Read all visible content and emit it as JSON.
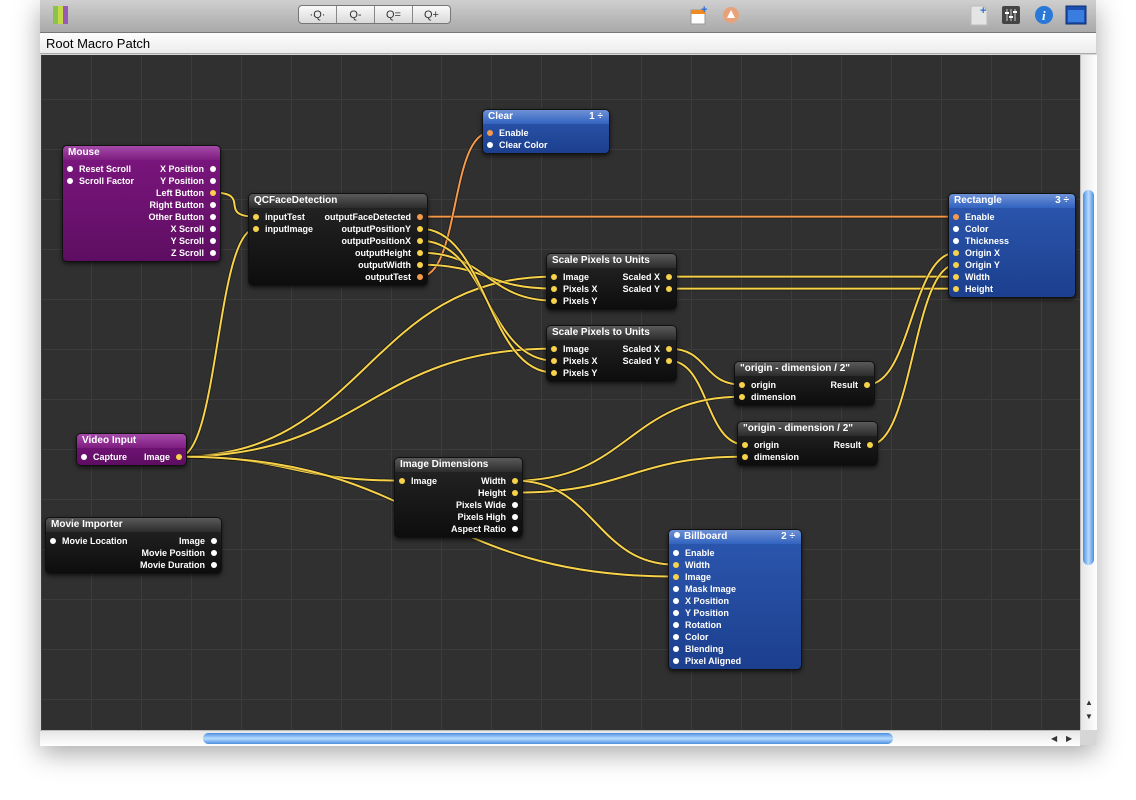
{
  "toolbar": {
    "icons": [
      "patch-library-icon",
      "zoom-fit-icon",
      "zoom-out-icon",
      "zoom-actual-icon",
      "zoom-in-icon",
      "add-note-icon",
      "parent-patch-icon",
      "new-document-icon",
      "patch-parameters-icon",
      "patch-inspector-icon",
      "viewer-icon"
    ],
    "zoom_buttons": [
      "·Q·",
      "Q-",
      "Q=",
      "Q+"
    ]
  },
  "path_bar": {
    "title": "Root Macro Patch"
  },
  "colors": {
    "canvas": "#303030",
    "cable_value": "#f7d24a",
    "cable_boolean": "#f49a4a",
    "consumer_patch": "#2c58b0",
    "provider_patch": "#7d1680",
    "processor_patch": "#1a1a1a"
  },
  "patches": [
    {
      "id": "mouse",
      "title": "Mouse",
      "kind": "purple",
      "inputs": [
        "Reset Scroll",
        "Scroll Factor"
      ],
      "outputs": [
        "X Position",
        "Y Position",
        "Left Button",
        "Right Button",
        "Other Button",
        "X Scroll",
        "Y Scroll",
        "Z Scroll"
      ]
    },
    {
      "id": "face",
      "title": "QCFaceDetection",
      "kind": "dark",
      "inputs": [
        "inputTest",
        "inputImage"
      ],
      "outputs": [
        "outputFaceDetected",
        "outputPositionY",
        "outputPositionX",
        "outputHeight",
        "outputWidth",
        "outputTest"
      ]
    },
    {
      "id": "clear",
      "title": "Clear",
      "kind": "blue",
      "badge": "1 ÷",
      "inputs": [
        "Enable",
        "Clear Color"
      ],
      "outputs": []
    },
    {
      "id": "rect",
      "title": "Rectangle",
      "kind": "blue",
      "badge": "3 ÷",
      "inputs": [
        "Enable",
        "Color",
        "Thickness",
        "Origin X",
        "Origin Y",
        "Width",
        "Height"
      ],
      "outputs": []
    },
    {
      "id": "scale1",
      "title": "Scale Pixels to Units",
      "kind": "dark",
      "inputs": [
        "Image",
        "Pixels X",
        "Pixels Y"
      ],
      "outputs": [
        "Scaled X",
        "Scaled Y"
      ]
    },
    {
      "id": "scale2",
      "title": "Scale Pixels to Units",
      "kind": "dark",
      "inputs": [
        "Image",
        "Pixels X",
        "Pixels Y"
      ],
      "outputs": [
        "Scaled X",
        "Scaled Y"
      ]
    },
    {
      "id": "orig1",
      "title": "\"origin - dimension / 2\"",
      "kind": "dark",
      "inputs": [
        "origin",
        "dimension"
      ],
      "outputs": [
        "Result"
      ]
    },
    {
      "id": "orig2",
      "title": "\"origin - dimension / 2\"",
      "kind": "dark",
      "inputs": [
        "origin",
        "dimension"
      ],
      "outputs": [
        "Result"
      ]
    },
    {
      "id": "video",
      "title": "Video Input",
      "kind": "purple",
      "inputs": [
        "Capture"
      ],
      "outputs": [
        "Image"
      ]
    },
    {
      "id": "imgdim",
      "title": "Image Dimensions",
      "kind": "dark",
      "inputs": [
        "Image"
      ],
      "outputs": [
        "Width",
        "Height",
        "Pixels Wide",
        "Pixels High",
        "Aspect Ratio"
      ]
    },
    {
      "id": "movie",
      "title": "Movie Importer",
      "kind": "dark",
      "inputs": [
        "Movie Location"
      ],
      "outputs": [
        "Image",
        "Movie Position",
        "Movie Duration"
      ]
    },
    {
      "id": "billboard",
      "title": "Billboard",
      "kind": "blue",
      "badge": "2 ÷",
      "title_port": true,
      "inputs": [
        "Enable",
        "Width",
        "Image",
        "Mask Image",
        "X Position",
        "Y Position",
        "Rotation",
        "Color",
        "Blending",
        "Pixel Aligned"
      ],
      "outputs": []
    }
  ],
  "connections": [
    {
      "from": "mouse.Left Button",
      "to": "face.inputTest",
      "type": "value"
    },
    {
      "from": "video.Image",
      "to": "face.inputImage",
      "type": "value"
    },
    {
      "from": "video.Image",
      "to": "scale1.Image",
      "type": "value"
    },
    {
      "from": "video.Image",
      "to": "scale2.Image",
      "type": "value"
    },
    {
      "from": "video.Image",
      "to": "imgdim.Image",
      "type": "value"
    },
    {
      "from": "video.Image",
      "to": "billboard.Image",
      "type": "value"
    },
    {
      "from": "face.outputFaceDetected",
      "to": "rect.Enable",
      "type": "boolean"
    },
    {
      "from": "face.outputTest",
      "to": "clear.Enable",
      "type": "boolean"
    },
    {
      "from": "face.outputWidth",
      "to": "scale1.Pixels X",
      "type": "value"
    },
    {
      "from": "face.outputHeight",
      "to": "scale1.Pixels Y",
      "type": "value"
    },
    {
      "from": "face.outputPositionX",
      "to": "scale2.Pixels X",
      "type": "value"
    },
    {
      "from": "face.outputPositionY",
      "to": "scale2.Pixels Y",
      "type": "value"
    },
    {
      "from": "scale1.Scaled X",
      "to": "rect.Width",
      "type": "value"
    },
    {
      "from": "scale1.Scaled Y",
      "to": "rect.Height",
      "type": "value"
    },
    {
      "from": "scale2.Scaled X",
      "to": "orig1.origin",
      "type": "value"
    },
    {
      "from": "scale2.Scaled Y",
      "to": "orig2.origin",
      "type": "value"
    },
    {
      "from": "imgdim.Width",
      "to": "orig1.dimension",
      "type": "value"
    },
    {
      "from": "imgdim.Height",
      "to": "orig2.dimension",
      "type": "value"
    },
    {
      "from": "imgdim.Width",
      "to": "billboard.Width",
      "type": "value"
    },
    {
      "from": "orig1.Result",
      "to": "rect.Origin X",
      "type": "value"
    },
    {
      "from": "orig2.Result",
      "to": "rect.Origin Y",
      "type": "value"
    }
  ]
}
